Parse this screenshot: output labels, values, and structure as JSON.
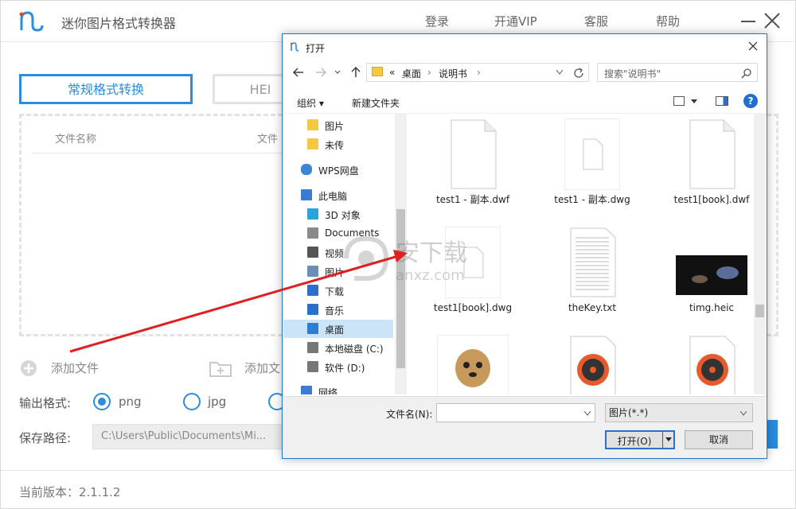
{
  "app": {
    "title": "迷你图片格式转换器",
    "nav": {
      "login": "登录",
      "vip": "开通VIP",
      "service": "客服",
      "help": "帮助"
    },
    "tabs": {
      "standard": "常规格式转换",
      "heic": "HEI"
    },
    "columns": {
      "filename": "文件名称",
      "filetype": "文件"
    },
    "actions": {
      "add_file": "添加文件",
      "add_folder": "添加文"
    },
    "output": {
      "label": "输出格式:",
      "options": [
        "png",
        "jpg"
      ],
      "selected": "png"
    },
    "save_path": {
      "label": "保存路径:",
      "value": "C:\\Users\\Public\\Documents\\Mi..."
    },
    "version": "当前版本：2.1.1.2",
    "accent_color": "#2a8de0"
  },
  "dialog": {
    "title": "打开",
    "address": {
      "prefix": "«",
      "crumbs": [
        "桌面",
        "说明书"
      ]
    },
    "search_placeholder": "搜索\"说明书\"",
    "commands": {
      "organize": "组织 ▾",
      "new_folder": "新建文件夹"
    },
    "nav_items": [
      {
        "label": "图片",
        "icon": "folder-icon"
      },
      {
        "label": "未传",
        "icon": "folder-icon"
      },
      {
        "label": "WPS网盘",
        "icon": "cloud-icon"
      },
      {
        "label": "此电脑",
        "icon": "computer-icon"
      },
      {
        "label": "3D 对象",
        "icon": "cube-icon"
      },
      {
        "label": "Documents",
        "icon": "document-icon"
      },
      {
        "label": "视频",
        "icon": "video-icon"
      },
      {
        "label": "图片",
        "icon": "picture-icon"
      },
      {
        "label": "下载",
        "icon": "download-icon"
      },
      {
        "label": "音乐",
        "icon": "music-icon"
      },
      {
        "label": "桌面",
        "icon": "desktop-icon"
      },
      {
        "label": "本地磁盘 (C:)",
        "icon": "drive-icon"
      },
      {
        "label": "软件 (D:)",
        "icon": "drive-icon"
      },
      {
        "label": "网络",
        "icon": "network-icon"
      }
    ],
    "files": [
      {
        "name": "test1 - 副本.dwf",
        "kind": "blank"
      },
      {
        "name": "test1 - 副本.dwg",
        "kind": "dwg"
      },
      {
        "name": "test1[book].dwf",
        "kind": "blank"
      },
      {
        "name": "test1[book].dwg",
        "kind": "dwg"
      },
      {
        "name": "theKey.txt",
        "kind": "txt"
      },
      {
        "name": "timg.heic",
        "kind": "image"
      },
      {
        "name": "",
        "kind": "dog"
      },
      {
        "name": "",
        "kind": "disc"
      },
      {
        "name": "",
        "kind": "disc"
      }
    ],
    "filename_label": "文件名(N):",
    "filename_value": "",
    "filetype": "图片(*.*)",
    "open_label": "打开(O)",
    "cancel_label": "取消"
  },
  "watermark": {
    "text": "安下载",
    "sub": "anxz.com"
  }
}
